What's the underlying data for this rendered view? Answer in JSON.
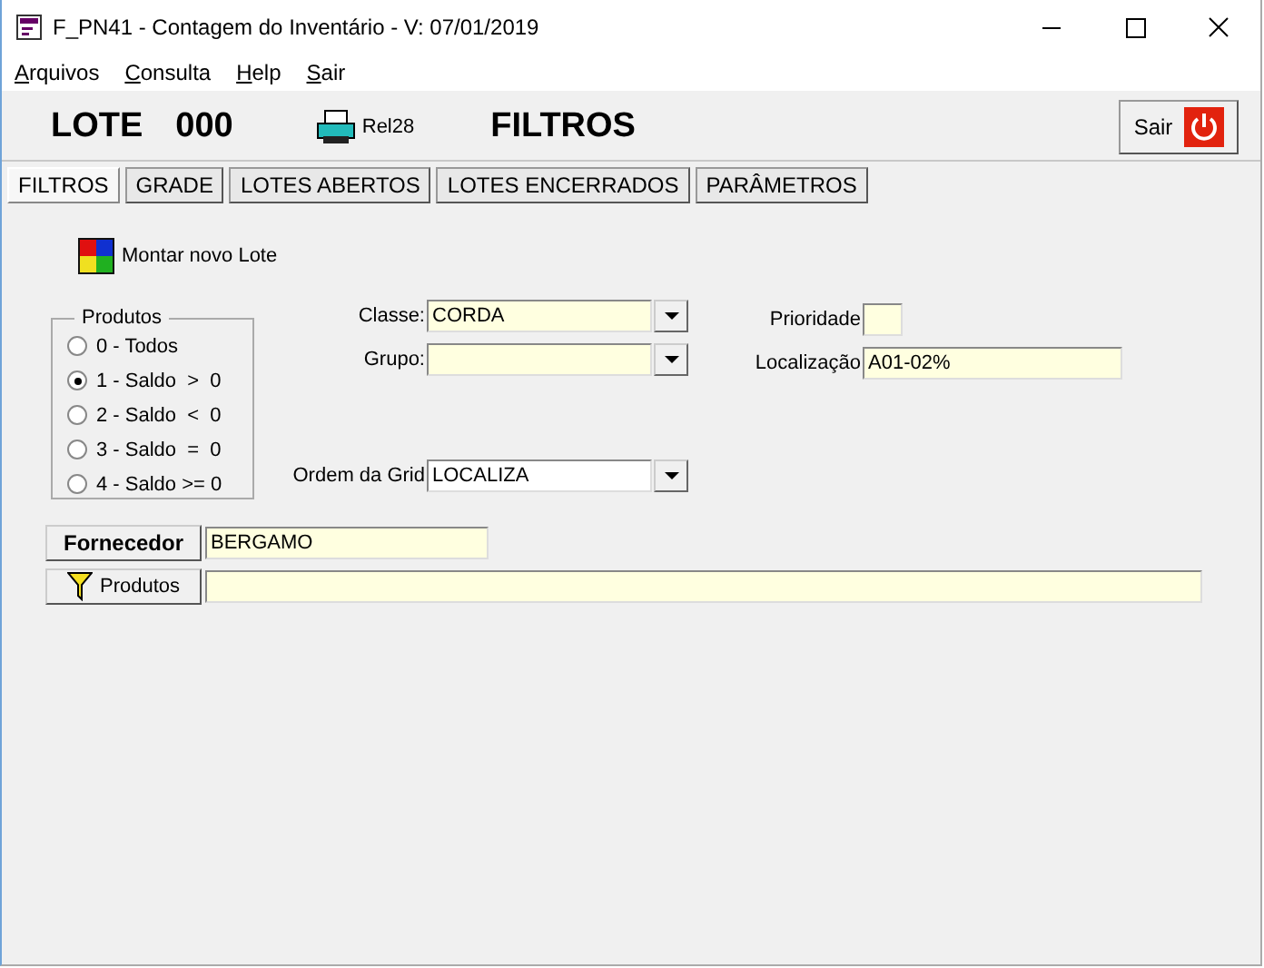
{
  "window": {
    "title": "F_PN41 - Contagem do Inventário - V: 07/01/2019"
  },
  "menu": [
    "Arquivos",
    "Consulta",
    "Help",
    "Sair"
  ],
  "header": {
    "lote_label": "LOTE",
    "lote_number": "000",
    "report": "Rel28",
    "section": "FILTROS",
    "exit": "Sair"
  },
  "tabs": [
    {
      "label": "FILTROS",
      "selected": true
    },
    {
      "label": "GRADE",
      "selected": false
    },
    {
      "label": "LOTES ABERTOS",
      "selected": false
    },
    {
      "label": "LOTES ENCERRADOS",
      "selected": false
    },
    {
      "label": "PARÂMETROS",
      "selected": false
    }
  ],
  "new_lot": "Montar novo Lote",
  "produtos_group": {
    "title": "Produtos",
    "options": [
      {
        "label": "0 - Todos",
        "selected": false
      },
      {
        "label": "1 - Saldo  >  0",
        "selected": true
      },
      {
        "label": "2 - Saldo  <  0",
        "selected": false
      },
      {
        "label": "3 - Saldo  =  0",
        "selected": false
      },
      {
        "label": "4 - Saldo >= 0",
        "selected": false
      }
    ]
  },
  "middle_fields": [
    {
      "label": "Classe:",
      "value": "CORDA",
      "kind": "dropdown"
    },
    {
      "label": "Grupo:",
      "kind": "dropdown"
    },
    {
      "label": "Ordem da Grid",
      "value": "LOCALIZA",
      "kind": "dropdown-white"
    }
  ],
  "right_fields": [
    {
      "label": "Prioridade",
      "kind": "short"
    },
    {
      "label": "Localização",
      "value": "A01-02%",
      "kind": "long"
    }
  ],
  "fornecedor": {
    "button": "Fornecedor",
    "value": "BERGAMO"
  },
  "produtos_filter": {
    "button": "Produtos"
  }
}
